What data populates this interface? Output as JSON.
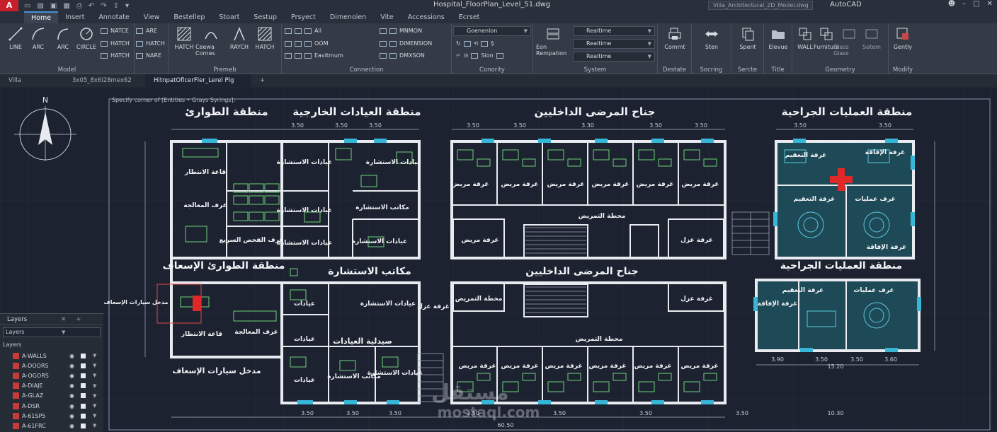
{
  "titlebar": {
    "logo": "A",
    "document_title": "Hospital_FloorPlan_Level_51.dwg",
    "search_text": "Villa_Architectural_2D_Model.dwg",
    "app_name": "AutoCAD"
  },
  "ribbon_tabs": [
    "Home",
    "Insert",
    "Annotate",
    "View",
    "Bestellep",
    "Stoart",
    "Sestup",
    "Prsyect",
    "Dimenoien",
    "Vite",
    "Accessions",
    "Ecrset"
  ],
  "ribbon": {
    "model": {
      "title": "Model",
      "tools": [
        "LINE",
        "ARC",
        "ARC",
        "CIRCLE"
      ],
      "small": [
        "NATCE",
        "HATCH",
        "HATCH",
        "ARE",
        "HATCH",
        "NARE"
      ]
    },
    "premeb": {
      "title": "Premeb",
      "tools": [
        "HATCH",
        "Ceewa Cornes",
        "RAYCH",
        "HATCH"
      ]
    },
    "connection": {
      "title": "Connection",
      "items": [
        "All",
        "OOM",
        "Eavitmum",
        "MNMON",
        "DIMENSION",
        "DMXSON"
      ]
    },
    "conority": {
      "title": "Conority",
      "combo": "Goenenlon",
      "items": [
        "Sion",
        "Sion"
      ]
    },
    "system": {
      "title": "System",
      "tool": "Eon Rempation",
      "combos": [
        "Realtime",
        "Realtime",
        "Realtime"
      ]
    },
    "destate": {
      "title": "Destate",
      "tool": "Commt"
    },
    "socring": {
      "title": "Socring",
      "tool": "Sten"
    },
    "sercte": {
      "title": "Sercte",
      "tool": "Spent"
    },
    "title_panel": {
      "title": "Title",
      "tool": "Elevue"
    },
    "geometry": {
      "title": "Geometry",
      "tools": [
        "WALL",
        "Furniture",
        "Glass Glass",
        "Sotem"
      ]
    },
    "modify": {
      "title": "Modify",
      "tool": "Gently"
    }
  },
  "file_tabs": [
    "Villa",
    "3x05_8x6i28mex62",
    "HitnpatOficerFler_Lerel Plg"
  ],
  "command_prompt": "Specify corner of [Entities • Grays Syrings]:",
  "compass": {
    "label": "N"
  },
  "layers_panel": {
    "title": "Layers",
    "combo": "Layers",
    "sub_title": "Layers",
    "layers": [
      "A-WALLS",
      "A-DOORS",
      "A-OGORS",
      "A-DIAJE",
      "A-GLAZ",
      "A-DSR",
      "A-61SP5",
      "A-61FRC"
    ]
  },
  "plan": {
    "zone_titles": {
      "emergency": "منطقة الطوارئ",
      "outpatient": "منطقة العيادات الخارجية",
      "inpatient": "جناح المرضى الداخليين",
      "surgery": "منطقة العمليات الجراحية",
      "emergency_ambulance": "منطقة الطوارئ الإسعاف",
      "consult_offices": "مكاتب الاستشارة",
      "inpatient_2": "جناح المرضى الداخليين",
      "surgery_2": "منطقة العمليات الجراحية"
    },
    "rooms": {
      "waiting": "قاعة الانتظار",
      "treatment": "غرف المعالجة",
      "exam": "غرف الفحص السريع",
      "clinic_consult": "عيادات الاستشارة",
      "consult_office": "مكاتب الاستشارة",
      "patient_room": "غرفة مريض",
      "nurse_station": "محطة التمريض",
      "isolation": "غرفة عزل",
      "sterilization": "غرفة التعقيم",
      "operating": "غرف عمليات",
      "recovery": "غرفة الإفاقة",
      "clinics": "عيادات",
      "pharmacy": "صيدلية العيادات",
      "ambulance_entry": "مدخل سيارات الإسعاف",
      "waiting_2": "قاعة الانتظار",
      "treatment_2": "غرف المعالجة"
    },
    "dimensions": {
      "top": [
        "3.50",
        "3.50",
        "3.50",
        "3.50",
        "3.50",
        "3.30",
        "3.50",
        "3.50",
        "3.50",
        "3.50"
      ],
      "bottom": [
        "3.50",
        "3.50",
        "3.50",
        "3.50",
        "3.50",
        "3.50",
        "3.50",
        "10.30"
      ],
      "surgery_bottom": [
        "3.90",
        "3.50",
        "3.50",
        "3.60"
      ],
      "total": "15.20",
      "overall": "60.50"
    }
  },
  "watermark": {
    "arabic": "مستقل",
    "latin": "mostaql.com"
  },
  "colors": {
    "background": "#1c2230",
    "wall": "#e8ecf0",
    "furniture": "#6fd07a",
    "window": "#38b6d8",
    "door": "#e04848",
    "surgery_fill": "#1e4a58",
    "red_cross": "#e02828"
  }
}
